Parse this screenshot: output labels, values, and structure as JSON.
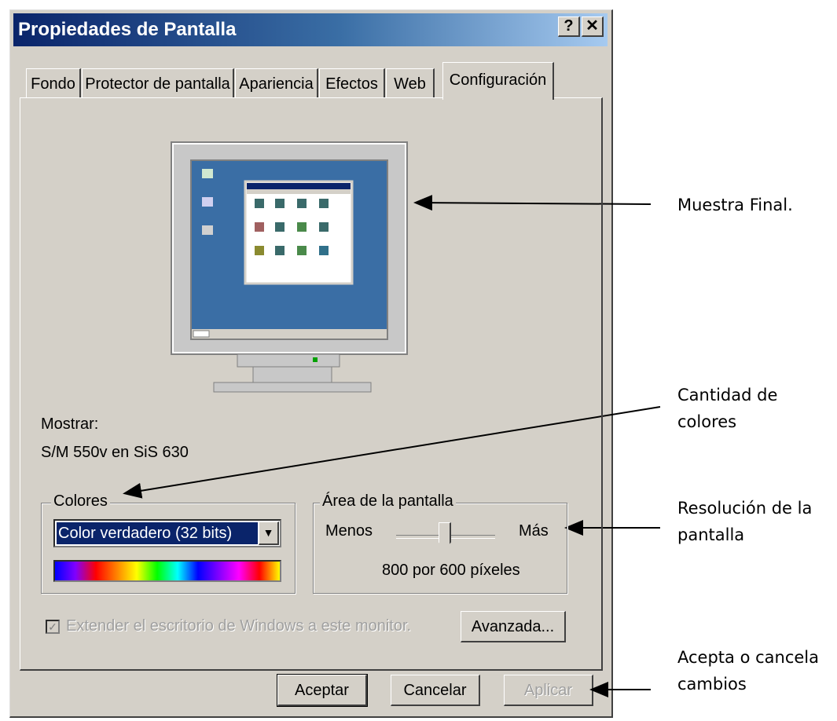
{
  "window": {
    "title": "Propiedades de Pantalla",
    "help_btn": "?",
    "close_btn": "✕"
  },
  "tabs": [
    {
      "label": "Fondo"
    },
    {
      "label": "Protector de pantalla"
    },
    {
      "label": "Apariencia"
    },
    {
      "label": "Efectos"
    },
    {
      "label": "Web"
    },
    {
      "label": "Configuración",
      "active": true
    }
  ],
  "display": {
    "label": "Mostrar:",
    "device": "S/M 550v en SiS 630"
  },
  "colors_group": {
    "legend": "Colores",
    "selected": "Color verdadero (32 bits)"
  },
  "screen_area": {
    "legend": "Área de la pantalla",
    "less": "Menos",
    "more": "Más",
    "resolution": "800 por 600 píxeles",
    "slider_level": 0.5
  },
  "extend_checkbox": {
    "label": "Extender el escritorio de Windows a este monitor.",
    "checked": true,
    "disabled": true
  },
  "buttons": {
    "advanced": "Avanzada...",
    "accept": "Aceptar",
    "cancel": "Cancelar",
    "apply": "Aplicar"
  },
  "annotations": {
    "preview": "Muestra Final.",
    "colors": "Cantidad de colores",
    "resolution": "Resolución de la pantalla",
    "accept_cancel": "Acepta o cancela cambios"
  },
  "accent_color": "#0a246a",
  "desktop_color": "#3a6ea5"
}
